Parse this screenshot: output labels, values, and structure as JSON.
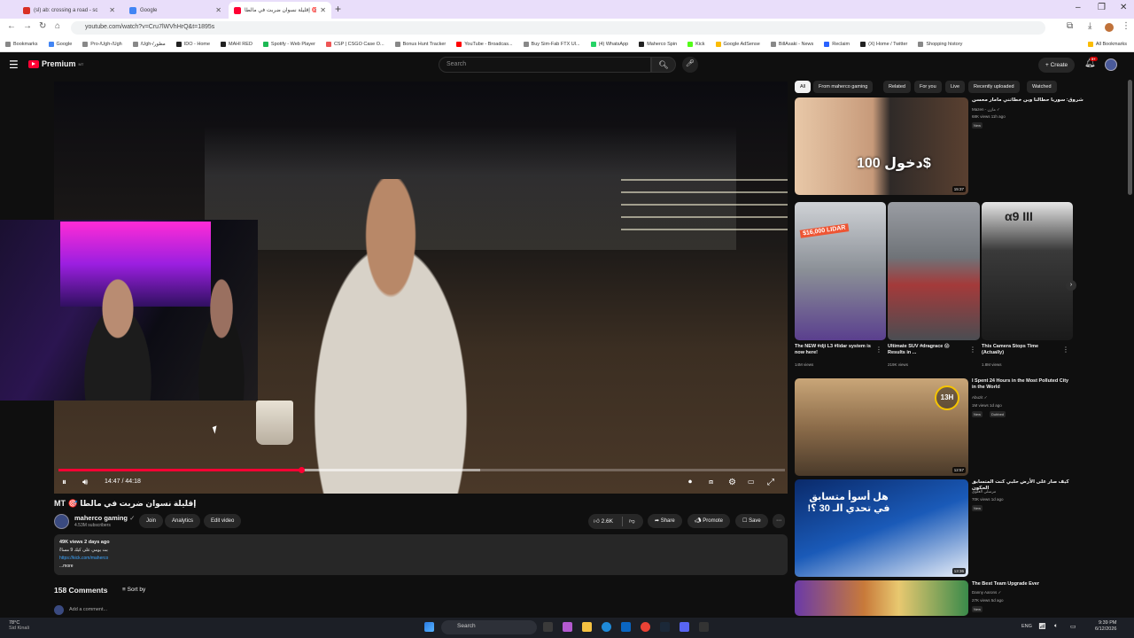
{
  "browser": {
    "tabs": [
      {
        "title": "(sl) ab: crossing a road - sc",
        "color": "#d93025"
      },
      {
        "title": "Google",
        "color": "#4285f4"
      },
      {
        "title": "إقليلة نسوان ضربت في مالطا 🎯",
        "color": "#ff0033"
      }
    ],
    "url": "youtube.com/watch?v=Cru7lWVhHrQ&t=1895s",
    "bookmarks": [
      "Bookmarks",
      "Google",
      "Pro-/Ugh-/Ugh",
      "/Ugh-/مطور",
      "IDO - Home",
      "MAHI RED",
      "Spotify - Web Player",
      "CSP | CSGO Case O...",
      "Bonus Hunt Tracker",
      "YouTube - Broadcas...",
      "Buy Sim-Fab FTX Ul...",
      "(4) WhatsApp",
      "Maherco Spin",
      "Kick",
      "Google AdSense",
      "BillAsaki - News",
      "Reclaim",
      "(X) Home / Twitter",
      "Shopping history",
      "All Bookmarks"
    ]
  },
  "yt": {
    "brand": "Premium",
    "brand_sup": "MT",
    "search_placeholder": "Search",
    "create_label": "Create",
    "notif_count": "9+"
  },
  "player": {
    "time": "14:47 / 44:18",
    "progress": 0.334,
    "buffer": 0.58
  },
  "video": {
    "title": "إقليلة نسوان ضربت في مالطا 🎯 MT",
    "channel": "maherco gaming",
    "subs": "4.53M subscribers",
    "join": "Join",
    "analytics": "Analytics",
    "edit": "Edit video",
    "likes": "2.6K",
    "share": "Share",
    "promote": "Promote",
    "save": "Save",
    "views": "49K views  2 days ago",
    "desc_line": "بث يومي على كيك 9 مساءً",
    "desc_link": "https://kick.com/maherco",
    "more": "...more",
    "comments": "158 Comments",
    "sort": "Sort by",
    "add_comment": "Add a comment..."
  },
  "chips": [
    "All",
    "From maherco gaming",
    "Related",
    "For you",
    "Live",
    "Recently uploaded",
    "Watched"
  ],
  "recs": [
    {
      "title": "شروق: سوريا حطالنا وين خطاتني مامار محسن",
      "channel": "Mazen - مازن ✓",
      "meta": "68K views  11h ago",
      "badge": "New",
      "duration": "15:37",
      "thumb_text": "دخول 100$"
    },
    {
      "title": "I Spent 24 Hours in the Most Polluted City in the World",
      "channel": "Abuzit ✓",
      "meta": "1M views  1d ago",
      "badge": "New",
      "badge2": "Dubbed",
      "duration": "12:57",
      "thumb_text": "13H"
    },
    {
      "title": "كيف صار على الأرض حلبي كنت المتسابق الحكون",
      "channel": "مرسلي العلوي",
      "meta": "70K views  1d ago",
      "badge": "New",
      "duration": "13:36",
      "thumb_text": "هل أسوأ متسابق في تحدي الـ 30 ؟!"
    },
    {
      "title": "The Best Team Upgrade Ever",
      "channel": "Danny Aarons ✓",
      "meta": "27K views  5d ago",
      "badge": "New",
      "duration": "",
      "thumb_text": ""
    }
  ],
  "shorts": [
    {
      "title": "The NEW #dji L3 #lidar system is now here!",
      "views": "14M views",
      "thumb_text": "$16,000 LIDAR"
    },
    {
      "title": "Ultimate SUV #dragrace 😱 Results in ...",
      "views": "219K views",
      "thumb_text": ""
    },
    {
      "title": "This Camera Stops Time (Actually)",
      "views": "1.8M views",
      "thumb_text": "α9 III"
    }
  ],
  "taskbar": {
    "temp": "78°C",
    "weather_desc": "Sid Kinali",
    "search": "Search",
    "lang": "ENG",
    "time": "9:39 PM",
    "date": "6/12/2026"
  }
}
